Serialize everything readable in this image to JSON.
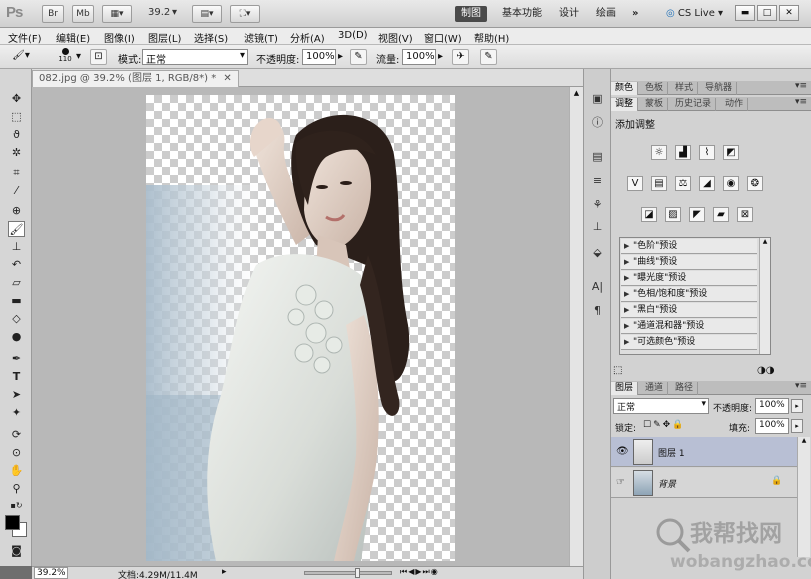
{
  "appbar": {
    "logo": "Ps",
    "br": "Br",
    "mb": "Mb",
    "zoom": "39.2",
    "workspaces": [
      "制图",
      "基本功能",
      "设计",
      "绘画"
    ],
    "more": "»",
    "cslive": "CS Live",
    "win_min": "▬",
    "win_max": "□",
    "win_close": "✕"
  },
  "menu": [
    "文件(F)",
    "编辑(E)",
    "图像(I)",
    "图层(L)",
    "选择(S)",
    "滤镜(T)",
    "分析(A)",
    "3D(D)",
    "视图(V)",
    "窗口(W)",
    "帮助(H)"
  ],
  "options": {
    "brush_size": "110",
    "mode_label": "模式:",
    "mode_value": "正常",
    "opacity_label": "不透明度:",
    "opacity_value": "100%",
    "flow_label": "流量:",
    "flow_value": "100%"
  },
  "document": {
    "tab_title": "082.jpg @ 39.2% (图层 1, RGB/8*) *",
    "tab_close": "✕"
  },
  "status": {
    "zoom": "39.2%",
    "doc_info": "文档:4.29M/11.4M"
  },
  "panels": {
    "top_tabs": [
      "颜色",
      "色板",
      "样式",
      "导航器"
    ],
    "adj_tabs": [
      "调整",
      "蒙板",
      "历史记录",
      "动作"
    ],
    "adj_title": "添加调整",
    "presets": [
      "\"色阶\"预设",
      "\"曲线\"预设",
      "\"曝光度\"预设",
      "\"色相/饱和度\"预设",
      "\"黑白\"预设",
      "\"通道混和器\"预设",
      "\"可选颜色\"预设"
    ],
    "layer_tabs": [
      "图层",
      "通道",
      "路径"
    ],
    "blend_mode": "正常",
    "opacity_label": "不透明度:",
    "opacity_value": "100%",
    "lock_label": "锁定:",
    "fill_label": "填充:",
    "fill_value": "100%",
    "layers": [
      {
        "name": "图层 1"
      },
      {
        "name": "背景"
      }
    ]
  },
  "watermark": {
    "brand": "我帮找网",
    "url": "wobangzhao.com"
  },
  "colors": {
    "fg": "#000000",
    "bg": "#ffffff",
    "selected_layer": "#b8bfd4"
  }
}
